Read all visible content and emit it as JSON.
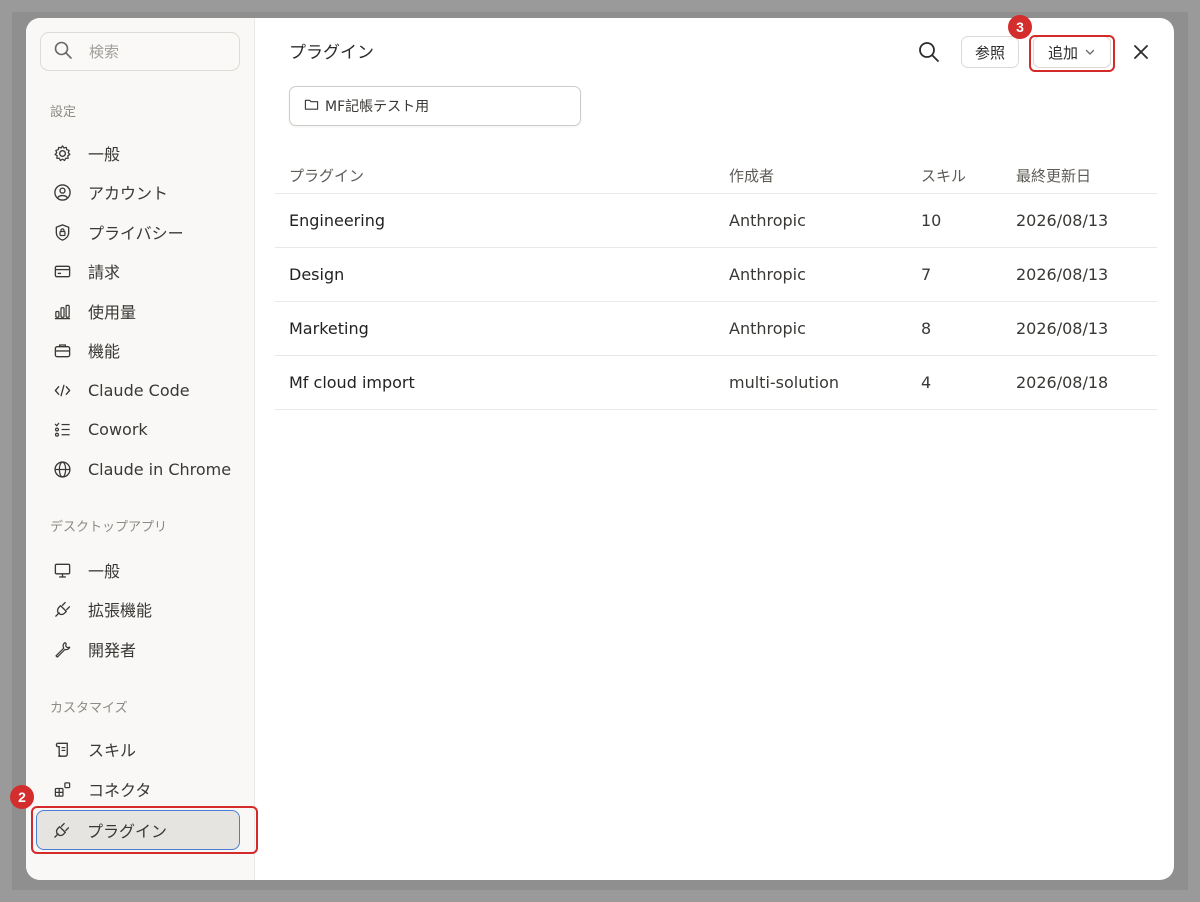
{
  "sidebar": {
    "search_placeholder": "検索",
    "sections": [
      {
        "label": "設定",
        "items": [
          {
            "label": "一般",
            "icon": "gear-icon"
          },
          {
            "label": "アカウント",
            "icon": "user-circle-icon"
          },
          {
            "label": "プライバシー",
            "icon": "shield-lock-icon"
          },
          {
            "label": "請求",
            "icon": "credit-card-icon"
          },
          {
            "label": "使用量",
            "icon": "bar-chart-icon"
          },
          {
            "label": "機能",
            "icon": "briefcase-icon"
          },
          {
            "label": "Claude Code",
            "icon": "code-icon"
          },
          {
            "label": "Cowork",
            "icon": "checklist-icon"
          },
          {
            "label": "Claude in Chrome",
            "icon": "globe-icon"
          }
        ]
      },
      {
        "label": "デスクトップアプリ",
        "items": [
          {
            "label": "一般",
            "icon": "monitor-icon"
          },
          {
            "label": "拡張機能",
            "icon": "plug-icon"
          },
          {
            "label": "開発者",
            "icon": "wrench-icon"
          }
        ]
      },
      {
        "label": "カスタマイズ",
        "items": [
          {
            "label": "スキル",
            "icon": "scroll-icon"
          },
          {
            "label": "コネクタ",
            "icon": "connector-icon"
          },
          {
            "label": "プラグイン",
            "icon": "plug-icon",
            "active": true
          }
        ]
      }
    ]
  },
  "annotations": {
    "badge_plugins": "2",
    "badge_add": "3",
    "highlight_color": "#d52a2a"
  },
  "header": {
    "title": "プラグイン",
    "browse_label": "参照",
    "add_label": "追加"
  },
  "folder_chip": {
    "label": "MF記帳テスト用"
  },
  "table": {
    "columns": [
      "プラグイン",
      "作成者",
      "スキル",
      "最終更新日"
    ],
    "rows": [
      [
        "Engineering",
        "Anthropic",
        "10",
        "2026/08/13"
      ],
      [
        "Design",
        "Anthropic",
        "7",
        "2026/08/13"
      ],
      [
        "Marketing",
        "Anthropic",
        "8",
        "2026/08/13"
      ],
      [
        "Mf cloud import",
        "multi-solution",
        "4",
        "2026/08/18"
      ]
    ]
  }
}
